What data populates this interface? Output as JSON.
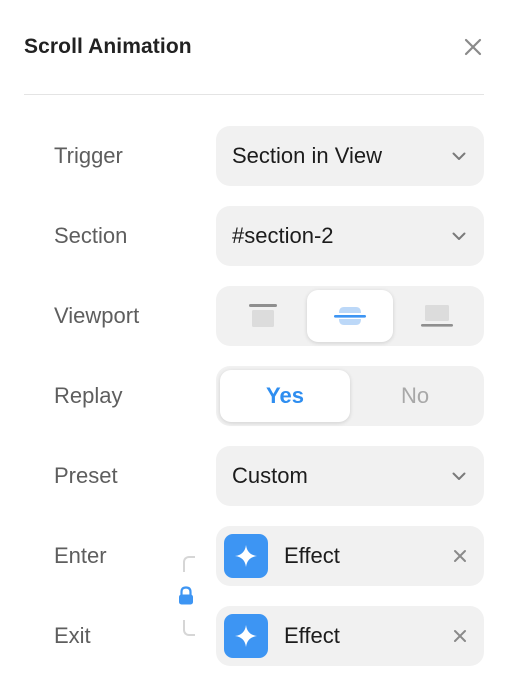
{
  "panel": {
    "title": "Scroll Animation",
    "close_icon": "close-icon"
  },
  "rows": {
    "trigger": {
      "label": "Trigger",
      "value": "Section in View"
    },
    "section": {
      "label": "Section",
      "value": "#section-2"
    },
    "viewport": {
      "label": "Viewport",
      "options": [
        "viewport-top-icon",
        "viewport-center-icon",
        "viewport-bottom-icon"
      ],
      "selected": "viewport-center-icon"
    },
    "replay": {
      "label": "Replay",
      "options": [
        "Yes",
        "No"
      ],
      "selected": "Yes"
    },
    "preset": {
      "label": "Preset",
      "value": "Custom"
    },
    "enter": {
      "label": "Enter",
      "effect": "Effect",
      "icon": "sparkle-icon"
    },
    "exit": {
      "label": "Exit",
      "effect": "Effect",
      "icon": "sparkle-icon"
    }
  },
  "link": {
    "icon": "lock-icon"
  },
  "colors": {
    "accent": "#3d95f3",
    "accent_text": "#2f8ef0",
    "control_bg": "#f1f1f1",
    "label": "#5e5e5e"
  }
}
